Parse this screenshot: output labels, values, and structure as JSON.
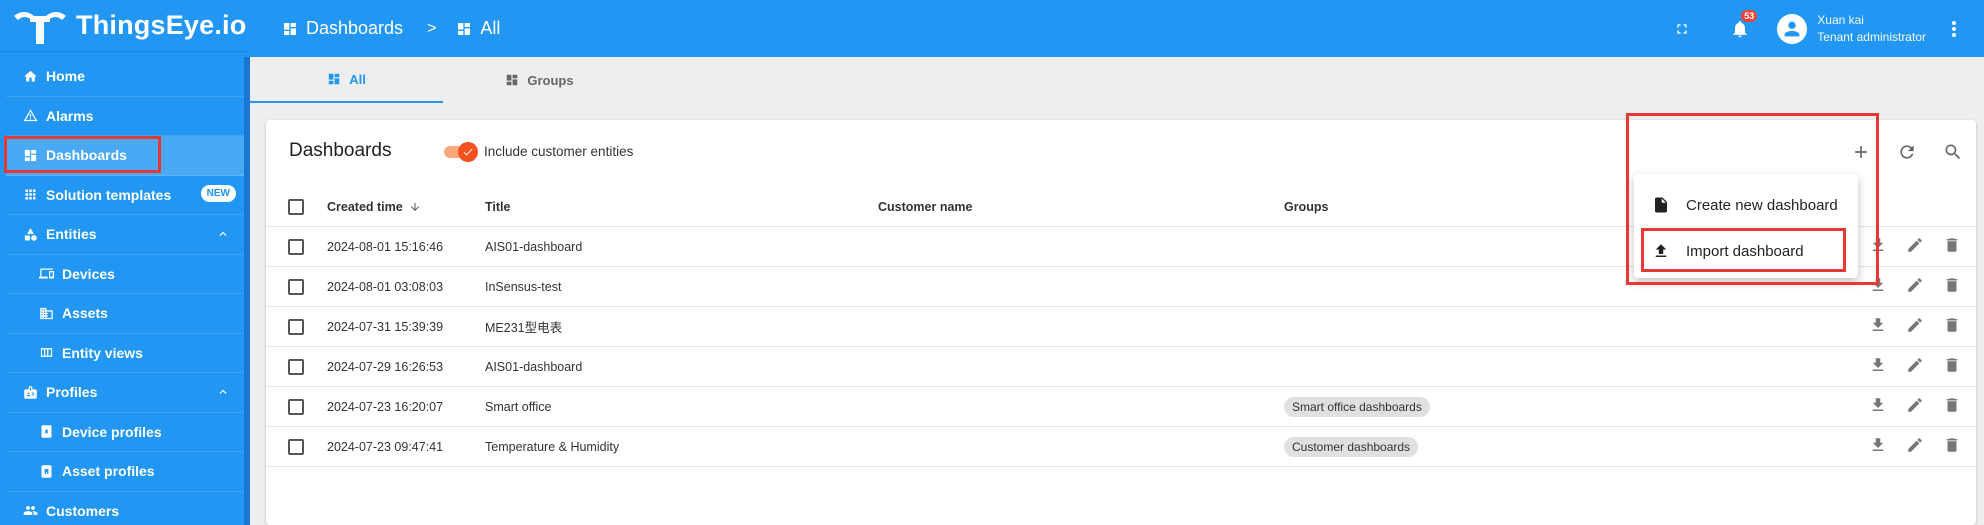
{
  "app": {
    "logo_text": "ThingsEye.io"
  },
  "sidebar": {
    "items": [
      {
        "label": "Home",
        "icon": "home-icon"
      },
      {
        "label": "Alarms",
        "icon": "warning-icon"
      },
      {
        "label": "Dashboards",
        "icon": "dashboard-icon",
        "active": true
      },
      {
        "label": "Solution templates",
        "icon": "apps-icon",
        "badge": "NEW"
      },
      {
        "label": "Entities",
        "icon": "category-icon",
        "expanded": true
      },
      {
        "label": "Devices",
        "icon": "devices-icon"
      },
      {
        "label": "Assets",
        "icon": "domain-icon"
      },
      {
        "label": "Entity views",
        "icon": "view-quilt-icon"
      },
      {
        "label": "Profiles",
        "icon": "badge-icon",
        "expanded": true
      },
      {
        "label": "Device profiles",
        "icon": "device-profile-icon"
      },
      {
        "label": "Asset profiles",
        "icon": "asset-profile-icon"
      },
      {
        "label": "Customers",
        "icon": "people-icon"
      }
    ]
  },
  "header": {
    "breadcrumb": [
      "Dashboards",
      "All"
    ],
    "breadcrumb_sep": ">",
    "notifications_count": "53",
    "user": {
      "name": "Xuan kai",
      "role": "Tenant administrator"
    }
  },
  "tabs": [
    {
      "label": "All",
      "active": true
    },
    {
      "label": "Groups",
      "active": false
    }
  ],
  "card": {
    "title": "Dashboards",
    "toggle_label": "Include customer entities",
    "toggle_on": true
  },
  "table": {
    "columns": [
      "Created time",
      "Title",
      "Customer name",
      "Groups"
    ],
    "rows": [
      {
        "created": "2024-08-01 15:16:46",
        "title": "AIS01-dashboard",
        "customer": "",
        "group": ""
      },
      {
        "created": "2024-08-01 03:08:03",
        "title": "InSensus-test",
        "customer": "",
        "group": ""
      },
      {
        "created": "2024-07-31 15:39:39",
        "title": "ME231型电表",
        "customer": "",
        "group": ""
      },
      {
        "created": "2024-07-29 16:26:53",
        "title": "AIS01-dashboard",
        "customer": "",
        "group": ""
      },
      {
        "created": "2024-07-23 16:20:07",
        "title": "Smart office",
        "customer": "",
        "group": "Smart office dashboards"
      },
      {
        "created": "2024-07-23 09:47:41",
        "title": "Temperature & Humidity",
        "customer": "",
        "group": "Customer dashboards"
      }
    ]
  },
  "add_menu": {
    "items": [
      {
        "label": "Create new dashboard",
        "icon": "file-icon"
      },
      {
        "label": "Import dashboard",
        "icon": "upload-icon"
      }
    ]
  },
  "colors": {
    "primary": "#2196f3",
    "highlight": "#e53935",
    "toggle": "#f4511e"
  }
}
